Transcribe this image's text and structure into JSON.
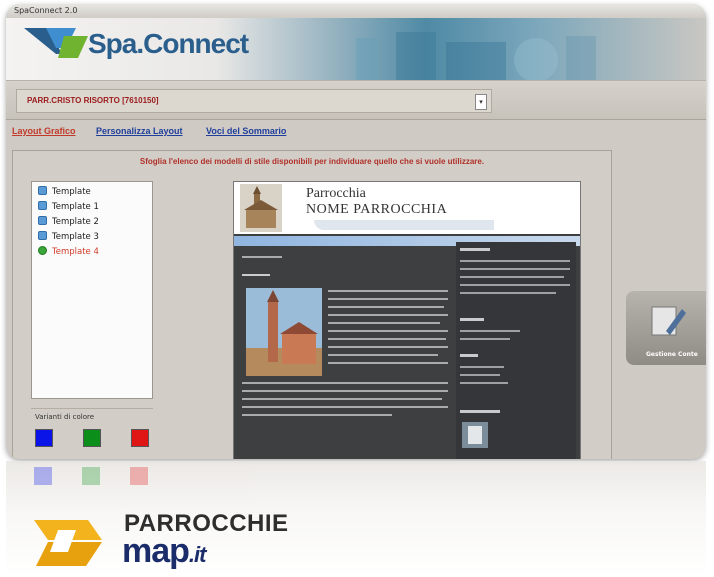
{
  "window": {
    "title": "SpaConnect 2.0"
  },
  "brand": {
    "name": "Spa.Connect"
  },
  "parish_selector": {
    "value": "PARR.CRISTO RISORTO [7610150]"
  },
  "tabs": [
    {
      "label": "Layout Grafico",
      "active": true
    },
    {
      "label": "Personalizza Layout",
      "active": false
    },
    {
      "label": "Voci del Sommario",
      "active": false
    }
  ],
  "instruction": "Sfoglia l'elenco dei modelli di stile disponibili per individuare quello che si vuole utilizzare.",
  "templates": [
    {
      "label": "Template",
      "selected": false
    },
    {
      "label": "Template 1",
      "selected": false
    },
    {
      "label": "Template 2",
      "selected": false
    },
    {
      "label": "Template 3",
      "selected": false
    },
    {
      "label": "Template 4",
      "selected": true
    }
  ],
  "color_variants": {
    "label": "Varianti di colore",
    "colors": [
      "#0a14e8",
      "#0b8f1a",
      "#e01616"
    ]
  },
  "preview": {
    "title_line1": "Parrocchia",
    "title_line2": "NOME PARROCCHIA"
  },
  "side_button": {
    "label": "Gestione Conte"
  },
  "footer_logo": {
    "brand": "PARROCCHIE",
    "domain": "map",
    "tld": ".it"
  },
  "colors": {
    "accent_red": "#b0302a",
    "link_blue": "#1f3f9c",
    "brand_blue": "#2a5e8c"
  }
}
